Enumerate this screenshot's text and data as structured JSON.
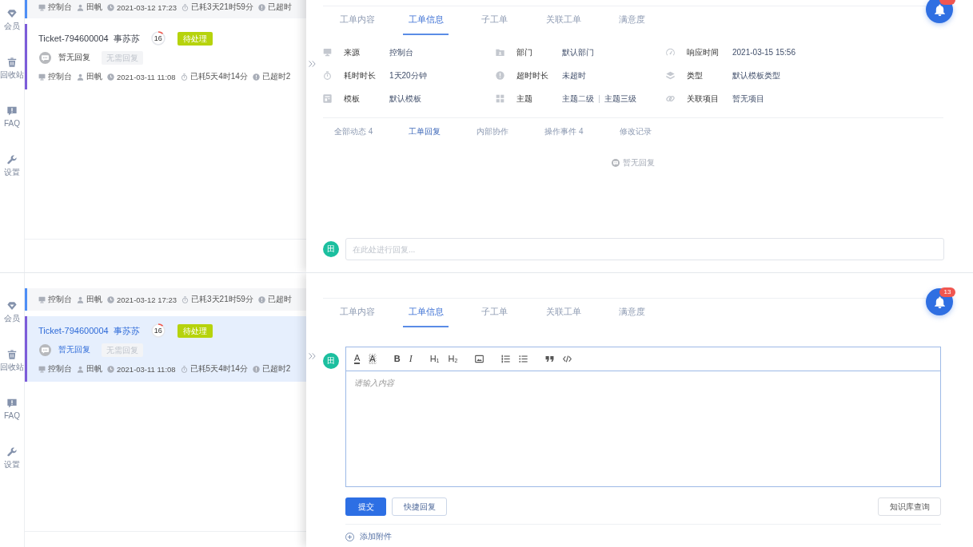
{
  "screens": [
    {
      "sidebar": [
        {
          "label": "会员"
        },
        {
          "label": "回收站"
        },
        {
          "label": "FAQ"
        },
        {
          "label": "设置"
        }
      ],
      "tickets": [
        {
          "kind": "partial",
          "selected": false,
          "color": "#4d8ef6",
          "meta": [
            {
              "kind": "source",
              "text": "控制台"
            },
            {
              "kind": "assignee",
              "text": "田帆"
            },
            {
              "kind": "created",
              "text": "2021-03-12 17:23"
            },
            {
              "kind": "elapsed",
              "text": "已耗3天21时59分"
            },
            {
              "kind": "overdue",
              "text": "已超时"
            }
          ]
        },
        {
          "kind": "full",
          "selected": false,
          "color": "#7c5cd9",
          "number": "Ticket-794600004",
          "customer": "事苏苏",
          "count": "16",
          "level": 0.12,
          "status": "待处理",
          "reply": "暂无回复",
          "reply_tag": "无需回复",
          "meta": [
            {
              "kind": "source",
              "text": "控制台"
            },
            {
              "kind": "assignee",
              "text": "田帆"
            },
            {
              "kind": "created",
              "text": "2021-03-11 11:08"
            },
            {
              "kind": "elapsed",
              "text": "已耗5天4时14分"
            },
            {
              "kind": "overdue",
              "text": "已超时2"
            }
          ]
        }
      ],
      "detail": {
        "tabs": [
          {
            "label": "工单内容",
            "selected": false
          },
          {
            "label": "工单信息",
            "selected": true
          },
          {
            "label": "子工单",
            "selected": false
          },
          {
            "label": "关联工单",
            "selected": false
          },
          {
            "label": "满意度",
            "selected": false
          }
        ],
        "fields": [
          {
            "kind": "source",
            "label": "来源",
            "value": "控制台"
          },
          {
            "kind": "department",
            "label": "部门",
            "value": "默认部门"
          },
          {
            "kind": "response-time",
            "label": "响应时间",
            "value": "2021-03-15 15:56"
          },
          {
            "kind": "duration",
            "label": "耗时时长",
            "value": "1天20分钟"
          },
          {
            "kind": "overtime",
            "label": "超时时长",
            "value": "未超时"
          },
          {
            "kind": "type",
            "label": "类型",
            "value": "默认模板类型"
          },
          {
            "kind": "template",
            "label": "模板",
            "value": "默认模板"
          },
          {
            "kind": "topic",
            "label": "主题",
            "values": [
              "主题二级",
              "主题三级"
            ]
          },
          {
            "kind": "project",
            "label": "关联项目",
            "value": "暂无项目"
          }
        ],
        "activity_tabs": [
          {
            "label": "全部动态",
            "count": "4",
            "selected": false
          },
          {
            "label": "工单回复",
            "selected": true
          },
          {
            "label": "内部协作",
            "selected": false
          },
          {
            "label": "操作事件",
            "count": "4",
            "selected": false
          },
          {
            "label": "修改记录",
            "selected": false
          }
        ],
        "empty_text": "暂无回复",
        "reply_box": {
          "avatar": "田",
          "placeholder": "在此处进行回复..."
        }
      },
      "notification": {
        "unread": true
      }
    },
    {
      "sidebar": [
        {
          "label": "会员"
        },
        {
          "label": "回收站"
        },
        {
          "label": "FAQ"
        },
        {
          "label": "设置"
        }
      ],
      "tickets": [
        {
          "kind": "partial",
          "selected": false,
          "color": "#4d8ef6",
          "meta": [
            {
              "kind": "source",
              "text": "控制台"
            },
            {
              "kind": "assignee",
              "text": "田帆"
            },
            {
              "kind": "created",
              "text": "2021-03-12 17:23"
            },
            {
              "kind": "elapsed",
              "text": "已耗3天21时59分"
            },
            {
              "kind": "overdue",
              "text": "已超时"
            }
          ]
        },
        {
          "kind": "full",
          "selected": true,
          "color": "#7c5cd9",
          "number": "Ticket-794600004",
          "customer": "事苏苏",
          "count": "16",
          "level": 0.12,
          "status": "待处理",
          "reply": "暂无回复",
          "reply_tag": "无需回复",
          "meta": [
            {
              "kind": "source",
              "text": "控制台"
            },
            {
              "kind": "assignee",
              "text": "田帆"
            },
            {
              "kind": "created",
              "text": "2021-03-11 11:08"
            },
            {
              "kind": "elapsed",
              "text": "已耗5天4时14分"
            },
            {
              "kind": "overdue",
              "text": "已超时2"
            }
          ]
        }
      ],
      "detail": {
        "tabs": [
          {
            "label": "工单内容",
            "selected": false
          },
          {
            "label": "工单信息",
            "selected": true
          },
          {
            "label": "子工单",
            "selected": false
          },
          {
            "label": "关联工单",
            "selected": false
          },
          {
            "label": "满意度",
            "selected": false
          }
        ],
        "editor": {
          "avatar": "田",
          "toolbar": [
            [
              {
                "kind": "font-color",
                "glyph": "A"
              },
              {
                "kind": "highlight",
                "glyph": "A"
              }
            ],
            [
              {
                "kind": "bold",
                "glyph": "B"
              },
              {
                "kind": "italic",
                "glyph": "I"
              }
            ],
            [
              {
                "kind": "heading",
                "glyph": "H$_{1}$"
              },
              {
                "kind": "heading",
                "glyph": "H$_{2}$"
              }
            ],
            [
              {
                "kind": "image"
              }
            ],
            [
              {
                "kind": "ordered-list"
              },
              {
                "kind": "bullet-list"
              }
            ],
            [
              {
                "kind": "quote"
              },
              {
                "kind": "code"
              }
            ]
          ],
          "placeholder": "请输入内容",
          "buttons": [
            {
              "kind": "submit",
              "label": "提交"
            },
            {
              "kind": "quick-reply",
              "label": "快捷回复"
            },
            {
              "kind": "knowledge-base",
              "label": "知识库查询"
            }
          ],
          "attachment": "添加附件"
        }
      },
      "notification": {
        "unread": true,
        "count": "13"
      }
    }
  ]
}
